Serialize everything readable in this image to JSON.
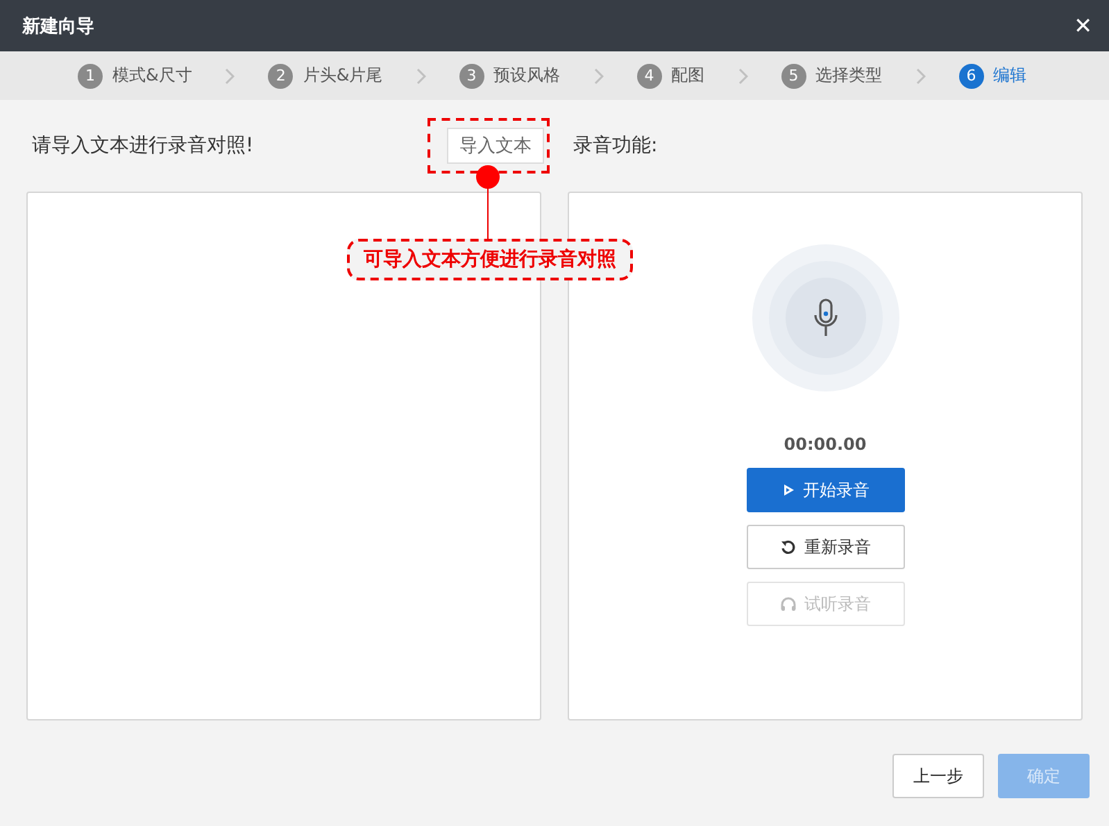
{
  "window": {
    "title": "新建向导",
    "close": "✕"
  },
  "steps": [
    {
      "number": "1",
      "label": "模式&尺寸",
      "selected": false
    },
    {
      "number": "2",
      "label": "片头&片尾",
      "selected": false
    },
    {
      "number": "3",
      "label": "预设风格",
      "selected": false
    },
    {
      "number": "4",
      "label": "配图",
      "selected": false
    },
    {
      "number": "5",
      "label": "选择类型",
      "selected": false
    },
    {
      "number": "6",
      "label": "编辑",
      "selected": true
    }
  ],
  "left_panel": {
    "heading": "请导入文本进行录音对照!",
    "import_button": "导入文本"
  },
  "right_panel": {
    "heading": "录音功能:",
    "timer": "00:00.00",
    "buttons": [
      {
        "label": "开始录音",
        "kind": "primary",
        "disabled": false
      },
      {
        "label": "重新录音",
        "kind": "secondary",
        "disabled": false
      },
      {
        "label": "试听录音",
        "kind": "secondary",
        "disabled": true
      }
    ]
  },
  "annotation": {
    "text": "可导入文本方便进行录音对照"
  },
  "footer": [
    {
      "label": "上一步",
      "kind": "secondary",
      "disabled": false
    },
    {
      "label": "确定",
      "kind": "primary",
      "disabled": true
    }
  ]
}
